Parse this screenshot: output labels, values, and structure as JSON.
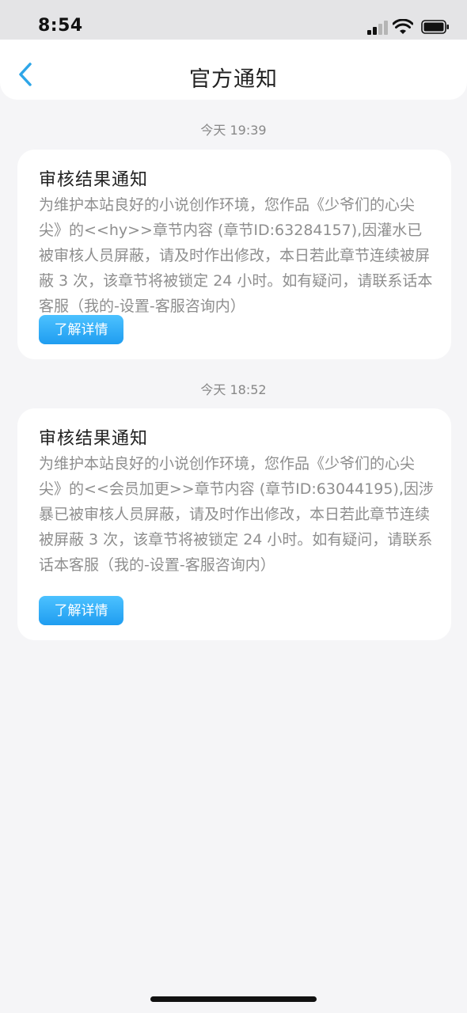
{
  "status_bar": {
    "time": "8:54",
    "icons": [
      "signal-icon",
      "wifi-icon",
      "battery-icon"
    ]
  },
  "nav": {
    "back_icon": "chevron-left-icon",
    "title": "官方通知"
  },
  "notifications": [
    {
      "timestamp": "今天 19:39",
      "title": "审核结果通知",
      "body": "为维护本站良好的小说创作环境，您作品《少爷们的心尖尖》的<<hy>>章节内容 (章节ID:63284157),因灌水已被审核人员屏蔽，请及时作出修改，本日若此章节连续被屏蔽 3 次，该章节将被锁定 24 小时。如有疑问，请联系话本客服（我的-设置-客服咨询内）",
      "button_label": "了解详情"
    },
    {
      "timestamp": "今天 18:52",
      "title": "审核结果通知",
      "body": "为维护本站良好的小说创作环境，您作品《少爷们的心尖尖》的<<会员加更>>章节内容 (章节ID:63044195),因涉暴已被审核人员屏蔽，请及时作出修改，本日若此章节连续被屏蔽 3 次，该章节将被锁定 24 小时。如有疑问，请联系话本客服（我的-设置-客服咨询内）",
      "button_label": "了解详情"
    }
  ],
  "colors": {
    "accent": "#1f9df0",
    "back_icon": "#2ea6e8",
    "background": "#f5f5f7"
  }
}
